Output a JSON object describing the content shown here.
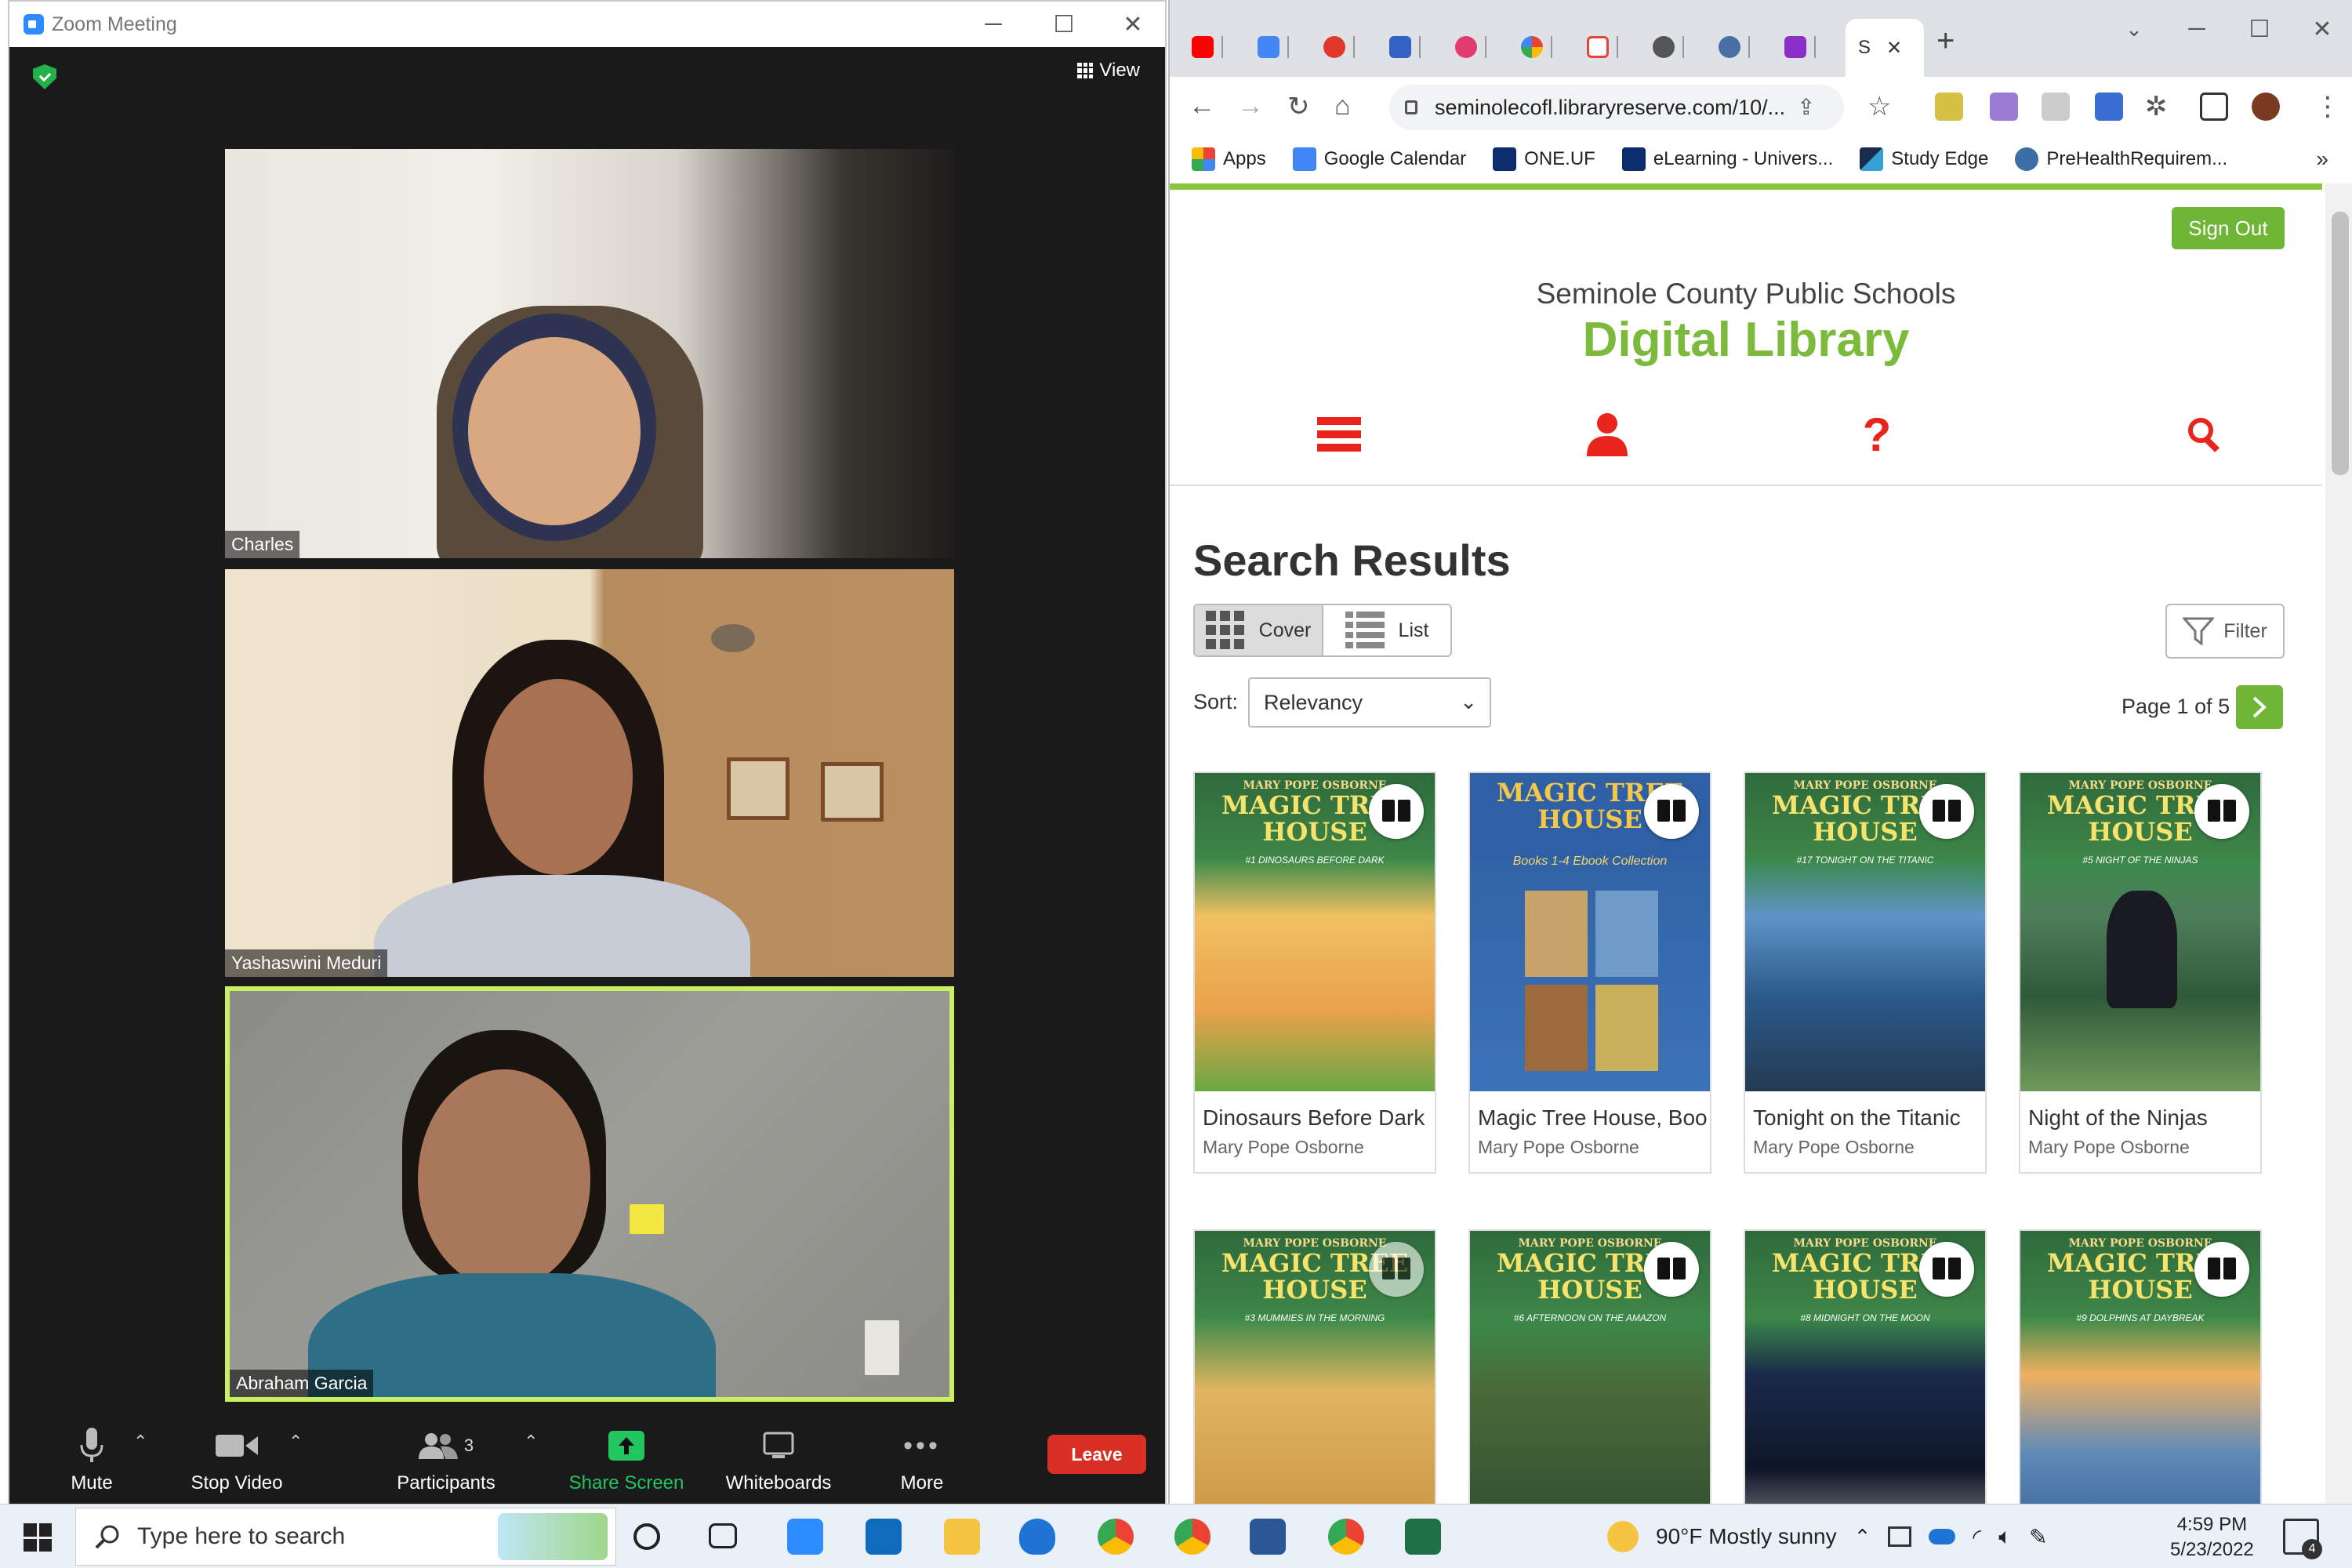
{
  "zoom": {
    "window_title": "Zoom Meeting",
    "view_label": "View",
    "participants": [
      {
        "name": "Charles"
      },
      {
        "name": "Yashaswini Meduri"
      },
      {
        "name": "Abraham Garcia"
      }
    ],
    "toolbar": {
      "mute": "Mute",
      "stop_video": "Stop Video",
      "participants": "Participants",
      "participant_count": "3",
      "share_screen": "Share Screen",
      "whiteboards": "Whiteboards",
      "more": "More",
      "leave": "Leave"
    },
    "accent": "#2d8cff",
    "leave_color": "#d93025",
    "share_color": "#22c55e"
  },
  "chrome": {
    "active_tab_label": "S",
    "address": "seminolecofl.libraryreserve.com/10/...",
    "bookmarks": [
      {
        "label": "Apps"
      },
      {
        "label": "Google Calendar"
      },
      {
        "label": "ONE.UF"
      },
      {
        "label": "eLearning - Univers..."
      },
      {
        "label": "Study Edge"
      },
      {
        "label": "PreHealthRequirem..."
      }
    ],
    "overflow": "»"
  },
  "library": {
    "sign_out": "Sign Out",
    "district": "Seminole County Public Schools",
    "title": "Digital Library",
    "brand_color": "#7cba3b",
    "nav_icon_color": "#e8241c",
    "search_results_title": "Search Results",
    "view_cover": "Cover",
    "view_list": "List",
    "filter": "Filter",
    "sort_label": "Sort:",
    "sort_value": "Relevancy",
    "page_info": "Page 1 of 5",
    "books": [
      {
        "title": "Dinosaurs Before Dark",
        "author": "Mary Pope Osborne",
        "series_author": "MARY POPE OSBORNE",
        "series": "MAGIC TREE HOUSE",
        "subtitle": "#1 DINOSAURS BEFORE DARK"
      },
      {
        "title": "Magic Tree House, Boo",
        "author": "Mary Pope Osborne",
        "series_author": "",
        "series": "MAGIC TREE HOUSE",
        "subtitle": "Books 1-4 Ebook Collection"
      },
      {
        "title": "Tonight on the Titanic",
        "author": "Mary Pope Osborne",
        "series_author": "MARY POPE OSBORNE",
        "series": "MAGIC TREE HOUSE",
        "subtitle": "#17 TONIGHT ON THE TITANIC"
      },
      {
        "title": "Night of the Ninjas",
        "author": "Mary Pope Osborne",
        "series_author": "MARY POPE OSBORNE",
        "series": "MAGIC TREE HOUSE",
        "subtitle": "#5 NIGHT OF THE NINJAS"
      },
      {
        "title": "",
        "author": "",
        "series_author": "MARY POPE OSBORNE",
        "series": "MAGIC TREE HOUSE",
        "subtitle": "#3 MUMMIES IN THE MORNING"
      },
      {
        "title": "",
        "author": "",
        "series_author": "MARY POPE OSBORNE",
        "series": "MAGIC TREE HOUSE",
        "subtitle": "#6 AFTERNOON ON THE AMAZON"
      },
      {
        "title": "",
        "author": "",
        "series_author": "MARY POPE OSBORNE",
        "series": "MAGIC TREE HOUSE",
        "subtitle": "#8 MIDNIGHT ON THE MOON"
      },
      {
        "title": "",
        "author": "",
        "series_author": "MARY POPE OSBORNE",
        "series": "MAGIC TREE HOUSE",
        "subtitle": "#9 DOLPHINS AT DAYBREAK"
      }
    ]
  },
  "taskbar": {
    "search_placeholder": "Type here to search",
    "weather": "90°F  Mostly sunny",
    "time": "4:59 PM",
    "date": "5/23/2022",
    "notifications": "4"
  }
}
